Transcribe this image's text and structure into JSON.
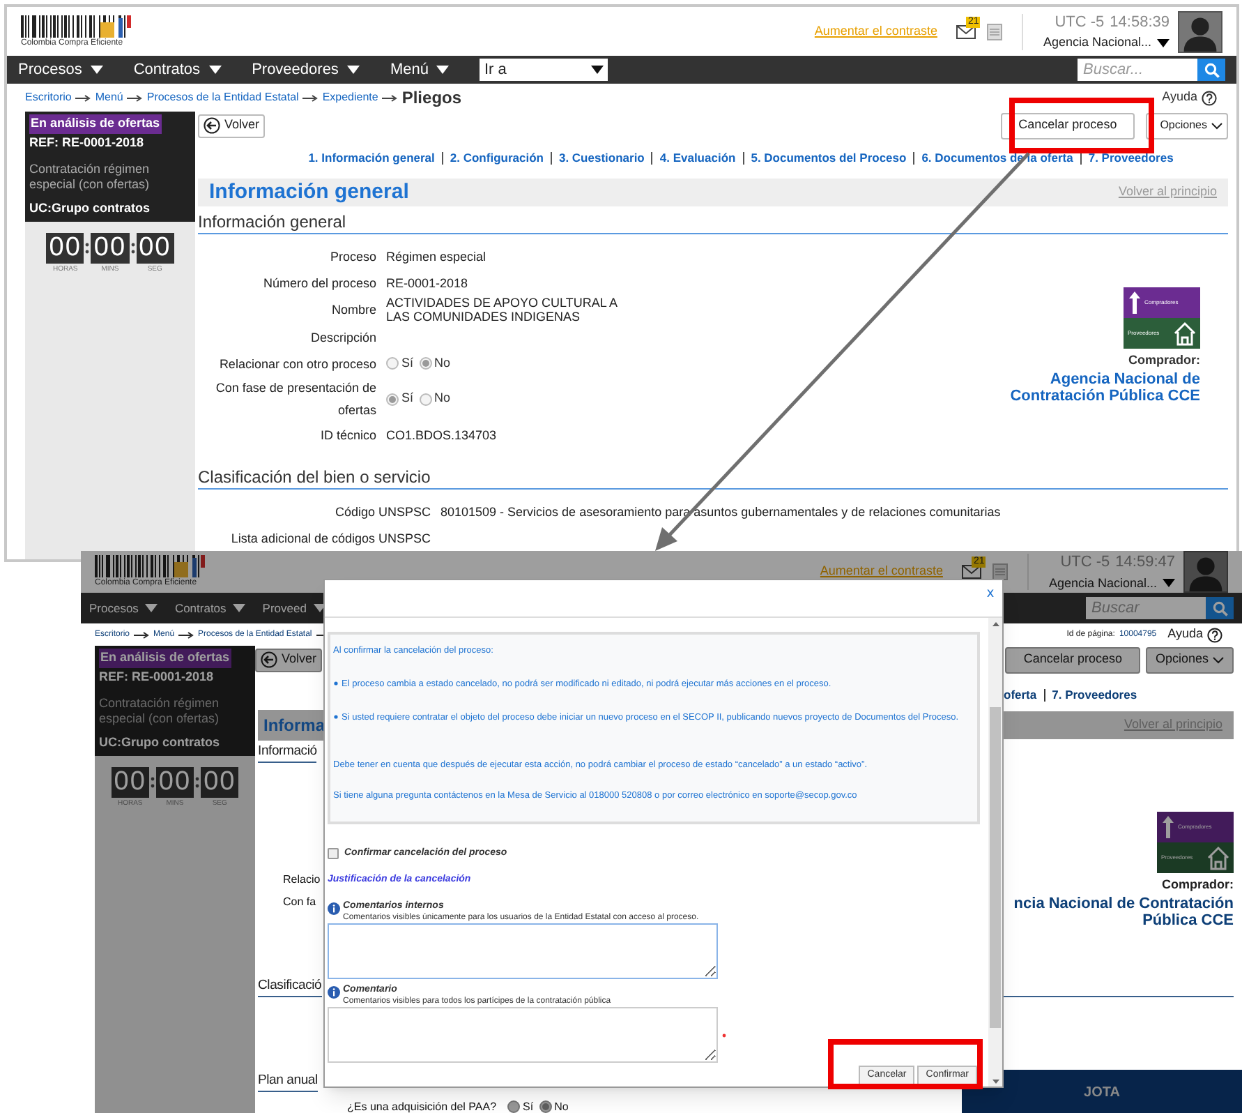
{
  "main_screen": {
    "header": {
      "logo_text": "Colombia Compra Eficiente",
      "contrast_link": "Aumentar el contraste",
      "mail_count": "21",
      "timezone": "UTC -5",
      "time": "14:58:39",
      "agency": "Agencia Nacional..."
    },
    "nav": {
      "items": [
        "Procesos",
        "Contratos",
        "Proveedores",
        "Menú"
      ],
      "goto": "Ir a",
      "search_placeholder": "Buscar..."
    },
    "breadcrumb": {
      "items": [
        "Escritorio",
        "Menú",
        "Procesos de la Entidad Estatal",
        "Expediente"
      ],
      "current": "Pliegos"
    },
    "help": "Ayuda",
    "sidebar": {
      "status": "En análisis de ofertas",
      "ref": "REF: RE-0001-2018",
      "type": "Contratación régimen especial (con ofertas)",
      "unit": "UC:Grupo contratos",
      "timer": [
        {
          "value": "00",
          "label": "HORAS"
        },
        {
          "value": "00",
          "label": "MINS"
        },
        {
          "value": "00",
          "label": "SEG"
        }
      ]
    },
    "back_button": "Volver",
    "cancel_button": "Cancelar proceso",
    "options_button": "Opciones",
    "steps": [
      "1. Información general",
      "2. Configuración",
      "3. Cuestionario",
      "4. Evaluación",
      "5. Documentos del Proceso",
      "6. Documentos de la oferta",
      "7. Proveedores"
    ],
    "page_title": "Información general",
    "back_to_top": "Volver al principio",
    "sections": [
      {
        "title": "Información general",
        "fields": [
          {
            "kind": "text",
            "label": "Proceso",
            "value": "Régimen especial"
          },
          {
            "kind": "text",
            "label": "Número del proceso",
            "value": "RE-0001-2018"
          },
          {
            "kind": "text",
            "label": "Nombre",
            "value": "ACTIVIDADES DE APOYO CULTURAL A LAS COMUNIDADES INDIGENAS"
          },
          {
            "kind": "text",
            "label": "Descripción"
          },
          {
            "kind": "radio",
            "label": "Relacionar con otro proceso",
            "options": [
              {
                "label": "Sí",
                "selected": false
              },
              {
                "label": "No",
                "selected": true
              }
            ]
          },
          {
            "kind": "radio",
            "label": "Con fase de presentación de ofertas",
            "options": [
              {
                "label": "Sí",
                "selected": true
              },
              {
                "label": "No",
                "selected": false
              }
            ]
          },
          {
            "kind": "text",
            "label": "ID técnico",
            "value": "CO1.BDOS.134703"
          }
        ]
      },
      {
        "title": "Clasificación del bien o servicio",
        "fields": [
          {
            "kind": "text",
            "label": "Código UNSPSC",
            "value": "80101509 - Servicios de asesoramiento para asuntos gubernamentales y de relaciones comunitarias"
          },
          {
            "kind": "text",
            "label": "Lista adicional de códigos UNSPSC"
          }
        ]
      }
    ],
    "buyer": {
      "badge_top": "Compradores",
      "badge_bottom": "Proveedores",
      "label": "Comprador:",
      "name": "Agencia Nacional de Contratación Pública CCE"
    }
  },
  "dialog_screen": {
    "header": {
      "logo_text": "Colombia Compra Eficiente",
      "contrast_link": "Aumentar el contraste",
      "mail_count": "21",
      "timezone": "UTC -5",
      "time": "14:59:47",
      "agency": "Agencia Nacional..."
    },
    "nav": {
      "items": [
        "Procesos",
        "Contratos",
        "Proveed"
      ],
      "search_placeholder": "Buscar"
    },
    "breadcrumb": {
      "items": [
        "Escritorio",
        "Menú",
        "Procesos de la Entidad Estatal"
      ]
    },
    "page_id_label": "Id de página:",
    "page_id": "10004795",
    "help": "Ayuda",
    "sidebar": {
      "status": "En análisis de ofertas",
      "ref": "REF: RE-0001-2018",
      "type": "Contratación régimen especial (con ofertas)",
      "unit": "UC:Grupo contratos",
      "timer": [
        {
          "value": "00",
          "label": "HORAS"
        },
        {
          "value": "00",
          "label": "MINS"
        },
        {
          "value": "00",
          "label": "SEG"
        }
      ]
    },
    "back_button": "Volver",
    "cancel_button": "Cancelar proceso",
    "options_button": "Opciones",
    "steps_tail": [
      "oferta",
      "7. Proveedores"
    ],
    "page_title": "Informa",
    "back_to_top": "Volver al principio",
    "left_texts": [
      {
        "kind": "heading",
        "text": "Informació"
      },
      {
        "kind": "label",
        "text": "Relacio"
      },
      {
        "kind": "label",
        "text": "Con fa"
      },
      {
        "kind": "heading",
        "text": "Clasificació"
      },
      {
        "kind": "heading",
        "text": "Plan anual"
      }
    ],
    "paa": {
      "label": "¿Es una adquisición del PAA?",
      "options": [
        {
          "label": "Sí",
          "selected": false
        },
        {
          "label": "No",
          "selected": true
        }
      ]
    },
    "buyer": {
      "badge_top": "Compradores",
      "badge_bottom": "Proveedores",
      "label": "Comprador:",
      "name": "ncia Nacional de Contratación Pública CCE"
    },
    "banner": "JOTA",
    "dialog": {
      "close": "x",
      "messages": [
        {
          "kind": "intro",
          "text": "Al confirmar la cancelación del proceso:"
        },
        {
          "kind": "bullet",
          "text": "El proceso cambia a estado cancelado, no podrá ser modificado ni editado, ni podrá ejecutar más acciones en el proceso."
        },
        {
          "kind": "bullet",
          "text": "Si usted requiere contratar el objeto del proceso debe iniciar un nuevo proceso en el SECOP II, publicando nuevos proyecto de Documentos del Proceso."
        },
        {
          "kind": "note",
          "text": "Debe tener en cuenta que después de ejecutar esta acción, no podrá cambiar el proceso de estado “cancelado” a un estado “activo”."
        },
        {
          "kind": "note",
          "text": "Si tiene alguna pregunta contáctenos en la Mesa de Servicio al 018000 520808 o por correo electrónico en soporte@secop.gov.co"
        }
      ],
      "confirm": {
        "label": "Confirmar cancelación del proceso",
        "checked": false
      },
      "justification": "Justificación de la cancelación",
      "comments": [
        {
          "title": "Comentarios internos",
          "hint": "Comentarios visibles únicamente para los usuarios de la Entidad Estatal con acceso al proceso.",
          "focused": true,
          "required": false
        },
        {
          "title": "Comentario",
          "hint": "Comentarios visibles para todos los partícipes de la contratación pública",
          "focused": false,
          "required": true
        }
      ],
      "buttons": [
        "Cancelar",
        "Confirmar"
      ]
    }
  }
}
